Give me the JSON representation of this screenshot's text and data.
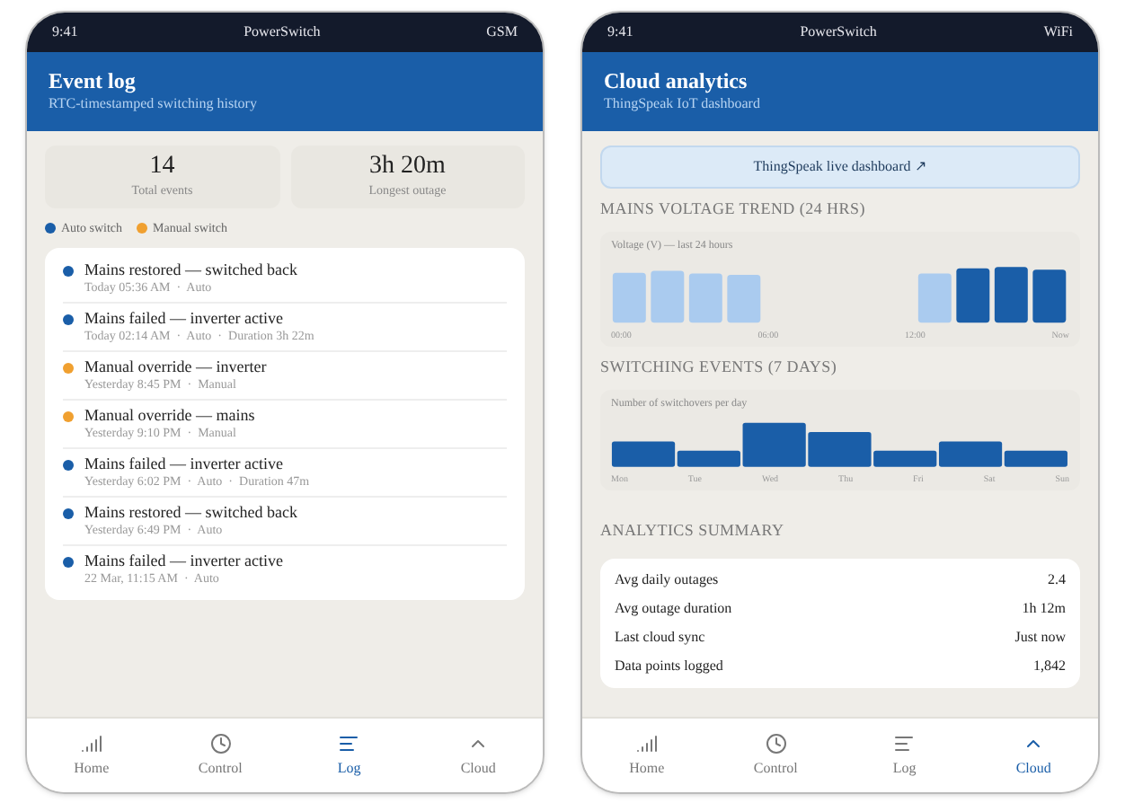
{
  "phones": [
    {
      "status_bar": {
        "time": "9:41",
        "app": "PowerSwitch",
        "network": "GSM"
      },
      "header": {
        "title": "Event log",
        "subtitle": "RTC-timestamped switching history"
      },
      "kind": "log",
      "stats": [
        {
          "value": "14",
          "label": "Total events"
        },
        {
          "value": "3h 20m",
          "label": "Longest outage"
        }
      ],
      "legend": [
        {
          "label": "Auto switch",
          "color": "#1a5ea8"
        },
        {
          "label": "Manual switch",
          "color": "#f0a030"
        }
      ],
      "events": [
        {
          "title": "Mains restored — switched back",
          "meta": "Today 05:36 AM  ·  Auto",
          "color": "#1a5ea8"
        },
        {
          "title": "Mains failed — inverter active",
          "meta": "Today 02:14 AM  ·  Auto  ·  Duration 3h 22m",
          "color": "#1a5ea8"
        },
        {
          "title": "Manual override — inverter",
          "meta": "Yesterday 8:45 PM  ·  Manual",
          "color": "#f0a030"
        },
        {
          "title": "Manual override — mains",
          "meta": "Yesterday 9:10 PM  ·  Manual",
          "color": "#f0a030"
        },
        {
          "title": "Mains failed — inverter active",
          "meta": "Yesterday 6:02 PM  ·  Auto  ·  Duration 47m",
          "color": "#1a5ea8"
        },
        {
          "title": "Mains restored — switched back",
          "meta": "Yesterday 6:49 PM  ·  Auto",
          "color": "#1a5ea8"
        },
        {
          "title": "Mains failed — inverter active",
          "meta": "22 Mar, 11:15 AM  ·  Auto",
          "color": "#1a5ea8"
        }
      ],
      "nav": [
        {
          "label": "Home",
          "selected": false
        },
        {
          "label": "Control",
          "selected": false
        },
        {
          "label": "Log",
          "selected": true
        },
        {
          "label": "Cloud",
          "selected": false
        }
      ]
    },
    {
      "status_bar": {
        "time": "9:41",
        "app": "PowerSwitch",
        "network": "WiFi"
      },
      "header": {
        "title": "Cloud analytics",
        "subtitle": "ThingSpeak IoT dashboard"
      },
      "kind": "cloud",
      "dashboard_button": "ThingSpeak live dashboard ↗",
      "voltage": {
        "heading": "MAINS VOLTAGE TREND (24 HRS)",
        "caption": "Voltage (V)  —  last 24 hours",
        "axis": [
          "00:00",
          "06:00",
          "12:00",
          "Now"
        ]
      },
      "switching": {
        "heading": "SWITCHING EVENTS (7 DAYS)",
        "caption": "Number of switchovers per day",
        "axis": [
          "Mon",
          "Tue",
          "Wed",
          "Thu",
          "Fri",
          "Sat",
          "Sun"
        ]
      },
      "summary": {
        "heading": "ANALYTICS SUMMARY",
        "rows": [
          {
            "label": "Avg daily outages",
            "value": "2.4"
          },
          {
            "label": "Avg outage duration",
            "value": "1h 12m"
          },
          {
            "label": "Last cloud sync",
            "value": "Just now"
          },
          {
            "label": "Data points logged",
            "value": "1,842"
          }
        ]
      },
      "nav": [
        {
          "label": "Home",
          "selected": false
        },
        {
          "label": "Control",
          "selected": false
        },
        {
          "label": "Log",
          "selected": false
        },
        {
          "label": "Cloud",
          "selected": true
        }
      ]
    }
  ]
}
